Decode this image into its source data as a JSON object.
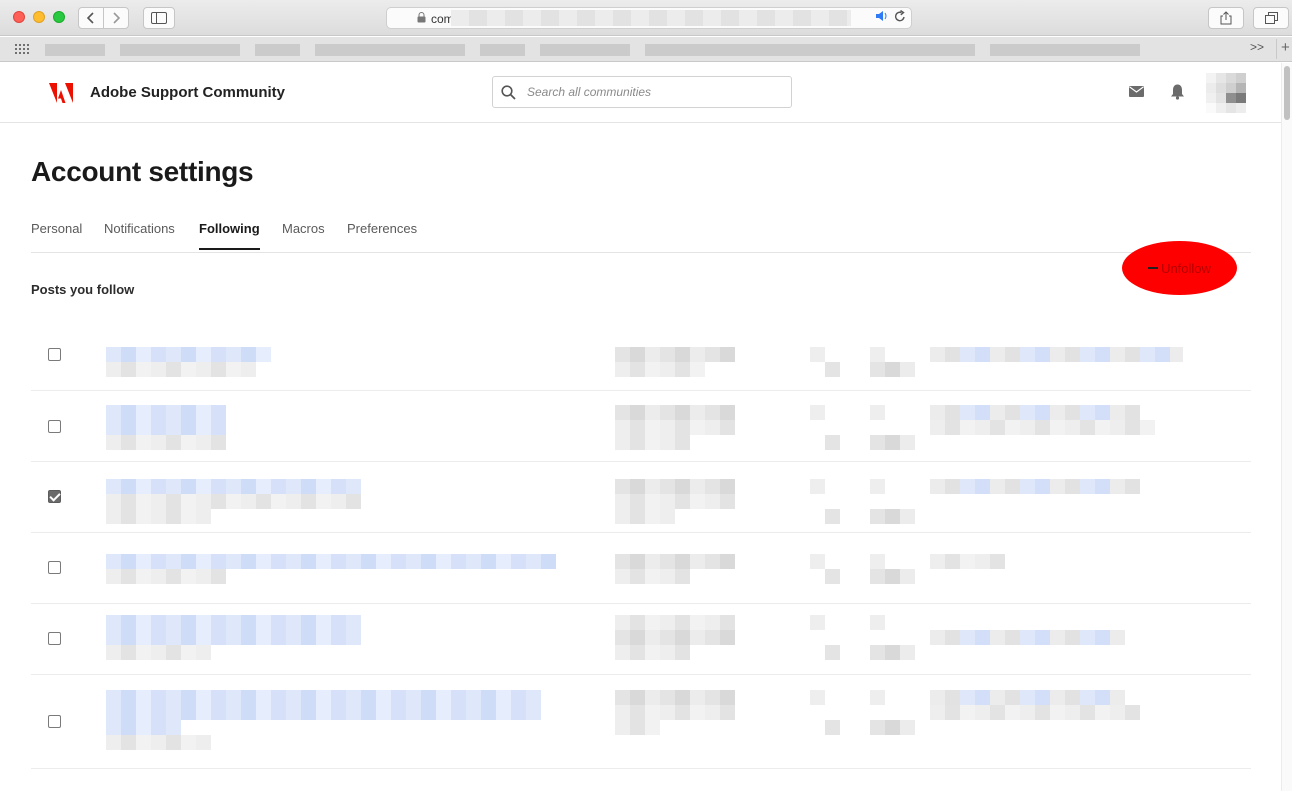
{
  "browser": {
    "url_visible": "com",
    "bookmarks_more": ">>",
    "bookmarks_add": "+"
  },
  "header": {
    "site_title": "Adobe Support Community",
    "search_placeholder": "Search all communities",
    "brand_color": "#eb1000"
  },
  "page": {
    "title": "Account settings",
    "tabs": [
      {
        "label": "Personal",
        "active": false
      },
      {
        "label": "Notifications",
        "active": false
      },
      {
        "label": "Following",
        "active": true
      },
      {
        "label": "Macros",
        "active": false
      },
      {
        "label": "Preferences",
        "active": false
      }
    ],
    "section_title": "Posts you follow",
    "unfollow_label": "Unfollow"
  },
  "posts": [
    {
      "checked": false
    },
    {
      "checked": false
    },
    {
      "checked": true
    },
    {
      "checked": false
    },
    {
      "checked": false
    },
    {
      "checked": false
    }
  ]
}
